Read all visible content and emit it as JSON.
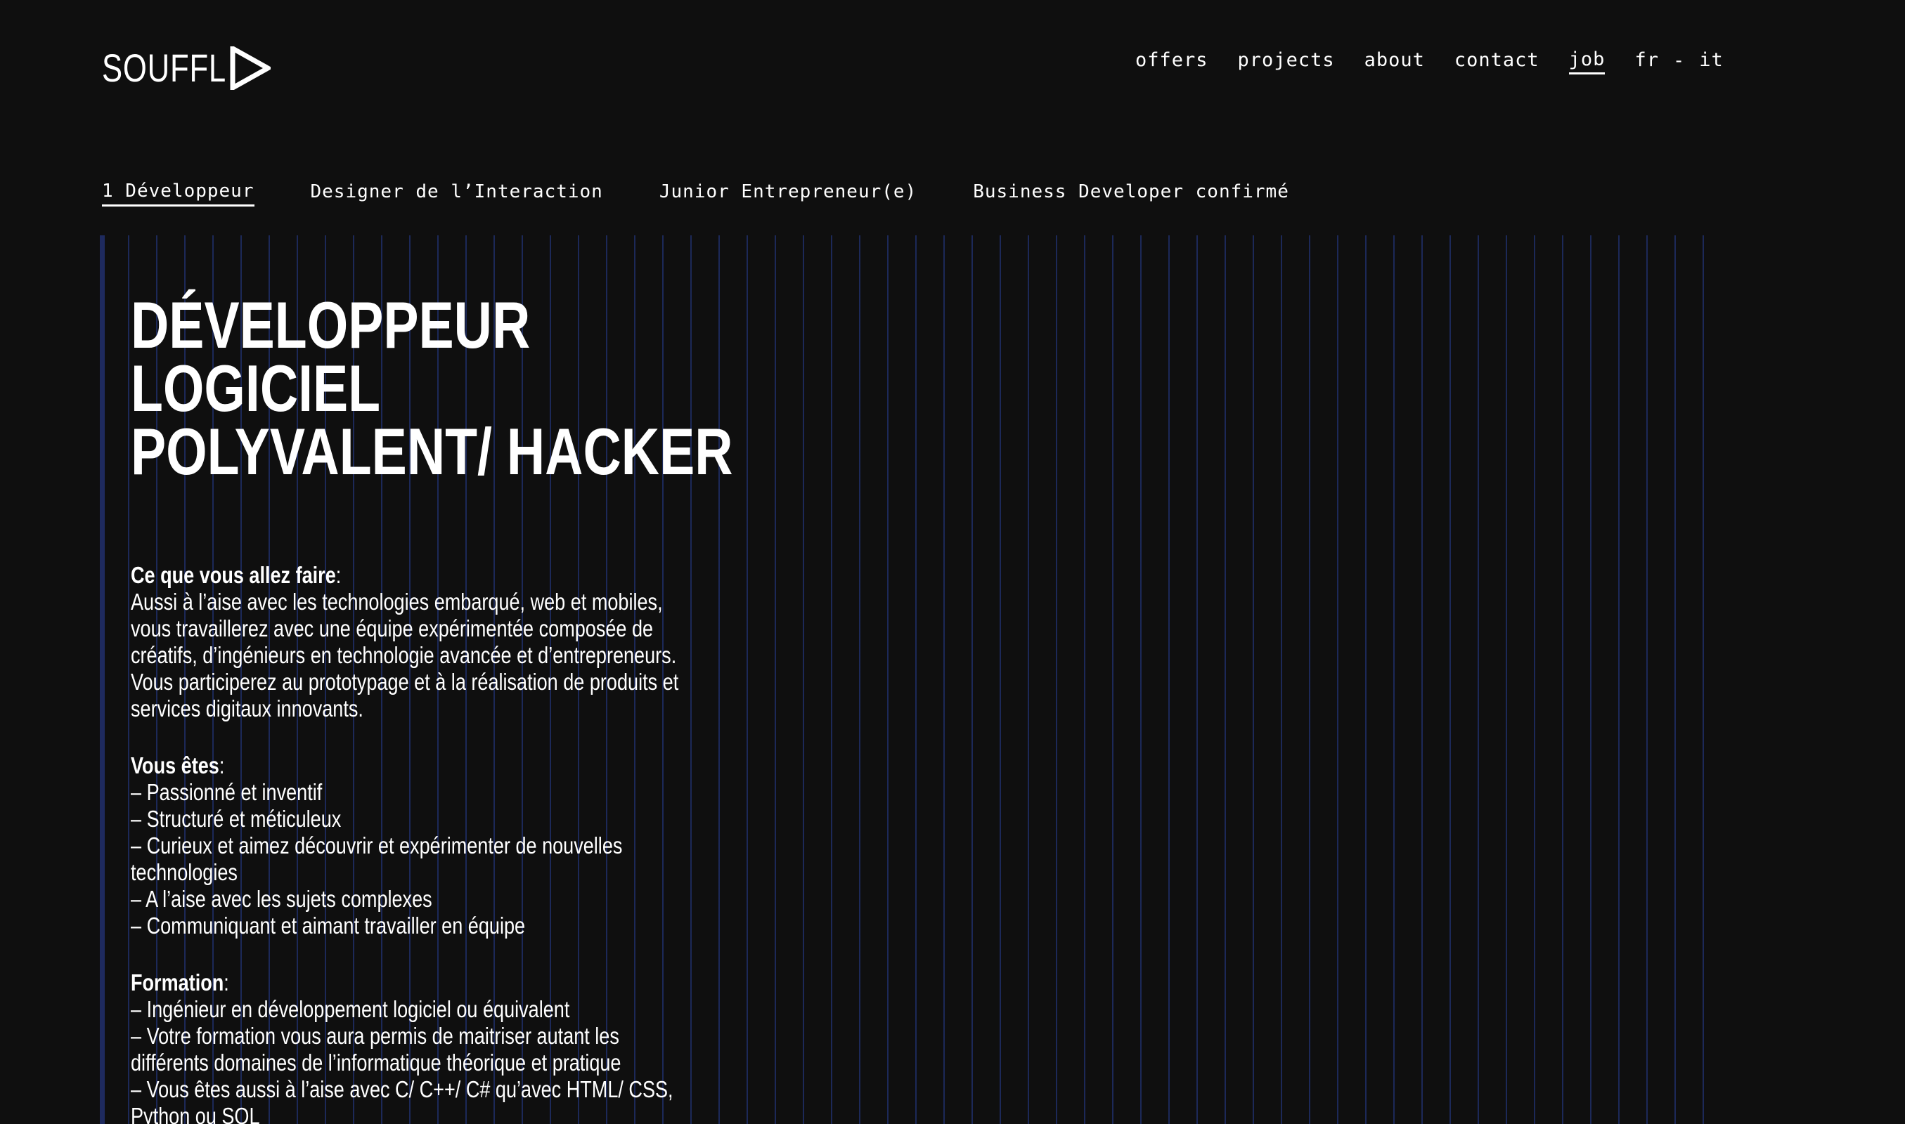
{
  "header": {
    "logo_text": "SOUFFL",
    "nav": [
      {
        "label": "offers",
        "active": false
      },
      {
        "label": "projects",
        "active": false
      },
      {
        "label": "about",
        "active": false
      },
      {
        "label": "contact",
        "active": false
      },
      {
        "label": "job",
        "active": true
      }
    ],
    "lang": {
      "fr": "fr",
      "separator": "-",
      "it": "it"
    }
  },
  "job_tabs": [
    {
      "label": "1 Développeur",
      "active": true
    },
    {
      "label": "Designer de l’Interaction",
      "active": false
    },
    {
      "label": "Junior Entrepreneur(e)",
      "active": false
    },
    {
      "label": "Business Developer confirmé",
      "active": false
    }
  ],
  "job": {
    "title_lines": [
      "DÉVELOPPEUR",
      "LOGICIEL",
      "POLYVALENT/ HACKER"
    ],
    "sections": [
      {
        "heading": "Ce que vous allez faire",
        "colon": ":",
        "lines": [
          "Aussi à l’aise avec les technologies embarqué, web et mobiles,",
          "vous travaillerez avec une équipe expérimentée composée de",
          "créatifs, d’ingénieurs en technologie avancée et d’entrepreneurs.",
          "Vous participerez au prototypage et à la réalisation de produits et",
          "services digitaux innovants."
        ]
      },
      {
        "heading": "Vous êtes",
        "colon": ":",
        "lines": [
          "– Passionné et inventif",
          "– Structuré et méticuleux",
          "– Curieux et aimez découvrir et expérimenter de nouvelles",
          "technologies",
          "– A l’aise avec les sujets complexes",
          "– Communiquant et aimant travailler en équipe"
        ]
      },
      {
        "heading": "Formation",
        "colon": ":",
        "lines": [
          "– Ingénieur en développement logiciel ou équivalent",
          "– Votre formation vous aura permis de maitriser autant les",
          "différents domaines de l’informatique théorique et pratique",
          "– Vous êtes aussi à l’aise avec C/ C++/ C# qu’avec HTML/ CSS,",
          "Python ou SQL"
        ]
      }
    ]
  },
  "colors": {
    "background": "#0f0f0f",
    "text": "#ffffff",
    "grid_line": "#1d2a5c"
  }
}
